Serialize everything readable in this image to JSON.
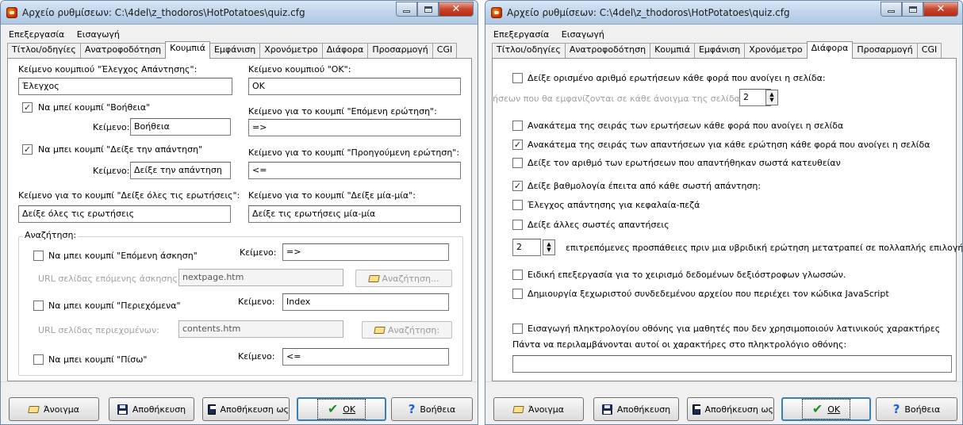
{
  "window_title": "Αρχείο ρυθμίσεων:  C:\\4del\\z_thodoros\\HotPotatoes\\quiz.cfg",
  "menu": {
    "items": [
      "Επεξεργασία",
      "Εισαγωγή"
    ]
  },
  "tabs": [
    "Τίτλοι/οδηγίες",
    "Ανατροφοδότηση",
    "Κουμπιά",
    "Εμφάνιση",
    "Χρονόμετρο",
    "Διάφορα",
    "Προσαρμογή",
    "CGI"
  ],
  "left": {
    "active_tab": "Κουμπιά",
    "check_label": "Κείμενο κουμπιού \"Έλεγχος Απάντησης\":",
    "check_value": "Έλεγχος",
    "ok_label": "Κείμενο κουμπιού \"OK\":",
    "ok_value": "OK",
    "hint_checkbox": "Να μπεί κουμπί \"Βοήθεια\"",
    "hint_text_label": "Κείμενο:",
    "hint_value": "Βοήθεια",
    "next_q_label": "Κείμενο για το κουμπί \"Επόμενη ερώτηση\":",
    "next_q_value": "=>",
    "show_answer_checkbox": "Να μπει κουμπί \"Δείξε την απάντηση\"",
    "show_answer_text_label": "Κείμενο:",
    "show_answer_value": "Δείξε την απάντηση",
    "prev_q_label": "Κείμενο για το κουμπί \"Προηγούμενη ερώτηση\":",
    "prev_q_value": "<=",
    "show_all_label": "Κείμενο για το κουμπί \"Δείξε όλες τις ερωτήσεις\":",
    "show_all_value": "Δείξε όλες τις ερωτήσεις",
    "one_by_one_label": "Κείμενο για το κουμπί \"Δείξε μία-μία\":",
    "one_by_one_value": "Δείξε τις ερωτήσεις μία-μία",
    "nav_group_label": "Αναζήτηση:",
    "next_ex_checkbox": "Να μπει κουμπί \"Επόμενη άσκηση\"",
    "next_ex_text_label": "Κείμενο:",
    "next_ex_value": "=>",
    "next_ex_url_label": "URL σελίδας επόμενης άσκησης:",
    "next_ex_url_value": "nextpage.htm",
    "browse1_label": "Αναζήτηση...",
    "contents_checkbox": "Να μπει κουμπί \"Περιεχόμενα\"",
    "contents_text_label": "Κείμενο:",
    "contents_value": "Index",
    "contents_url_label": "URL σελίδας περιεχομένων:",
    "contents_url_value": "contents.htm",
    "browse2_label": "Αναζήτηση:",
    "back_checkbox": "Να μπει κουμπί \"Πίσω\"",
    "back_text_label": "Κείμενο:",
    "back_value": "<="
  },
  "right": {
    "active_tab": "Διάφορα",
    "opt_fixed_count": "Δείξε ορισμένο αριθμό ερωτήσεων κάθε φορά που ανοίγει η σελίδα:",
    "opt_count_label": "ήσεων που θα εμφανίζονται σε κάθε άνοιγμα της σελίδας:",
    "opt_count_value": "2",
    "opt_shuffle_q": "Ανακάτεμα της σειράς των ερωτήσεων κάθε φορά που ανοίγει η σελίδα",
    "opt_shuffle_a": "Ανακάτεμα της σειράς των απαντήσεων για κάθε ερώτηση κάθε φορά που ανοίγει η σελίδα",
    "opt_show_correct_first": "Δείξε τον αριθμό των ερωτήσεων που απαντήθηκαν σωστά κατευθείαν",
    "opt_show_score": "Δείξε βαθμολογία έπειτα από κάθε σωστή απάντηση:",
    "opt_case_check": "Έλεγχος απάντησης για κεφαλαία-πεζά",
    "opt_other_correct": "Δείξε άλλες σωστές απαντήσεις",
    "opt_attempts_value": "2",
    "opt_attempts_label": "επιτρεπόμενες προσπάθειες πριν μια υβριδική ερώτηση μετατραπεί σε πολλαπλής επιλογής.",
    "opt_rtl": "Ειδική επεξεργασία για το χειρισμό δεδομένων δεξιόστροφων γλωσσών.",
    "opt_separate_js": "Δημιουργία ξεχωριστού συνδεδεμένου αρχείου που περιέχει τον κώδικα JavaScript",
    "opt_keyboard": "Εισαγωγή πληκτρολογίου οθόνης για μαθητές που δεν χρησιμοποιούν λατινικούς χαρακτήρες",
    "keyboard_chars_label": "Πάντα να περιλαμβάνονται αυτοί οι χαρακτήρες στο πληκτρολόγιο οθόνης:",
    "keyboard_chars_value": ""
  },
  "buttons": {
    "open": "Άνοιγμα",
    "save": "Αποθήκευση",
    "save_as": "Αποθήκευση ως",
    "ok": "OK",
    "help": "Βοήθεια"
  },
  "checkbox_states": {
    "left": {
      "hint": true,
      "show_answer": true,
      "next_ex": false,
      "contents": false,
      "back": false
    },
    "right": {
      "fixed_count": false,
      "shuffle_q": false,
      "shuffle_a": true,
      "show_correct_first": false,
      "show_score": true,
      "case_check": false,
      "other_correct": false,
      "rtl": false,
      "separate_js": false,
      "keyboard": false
    }
  }
}
